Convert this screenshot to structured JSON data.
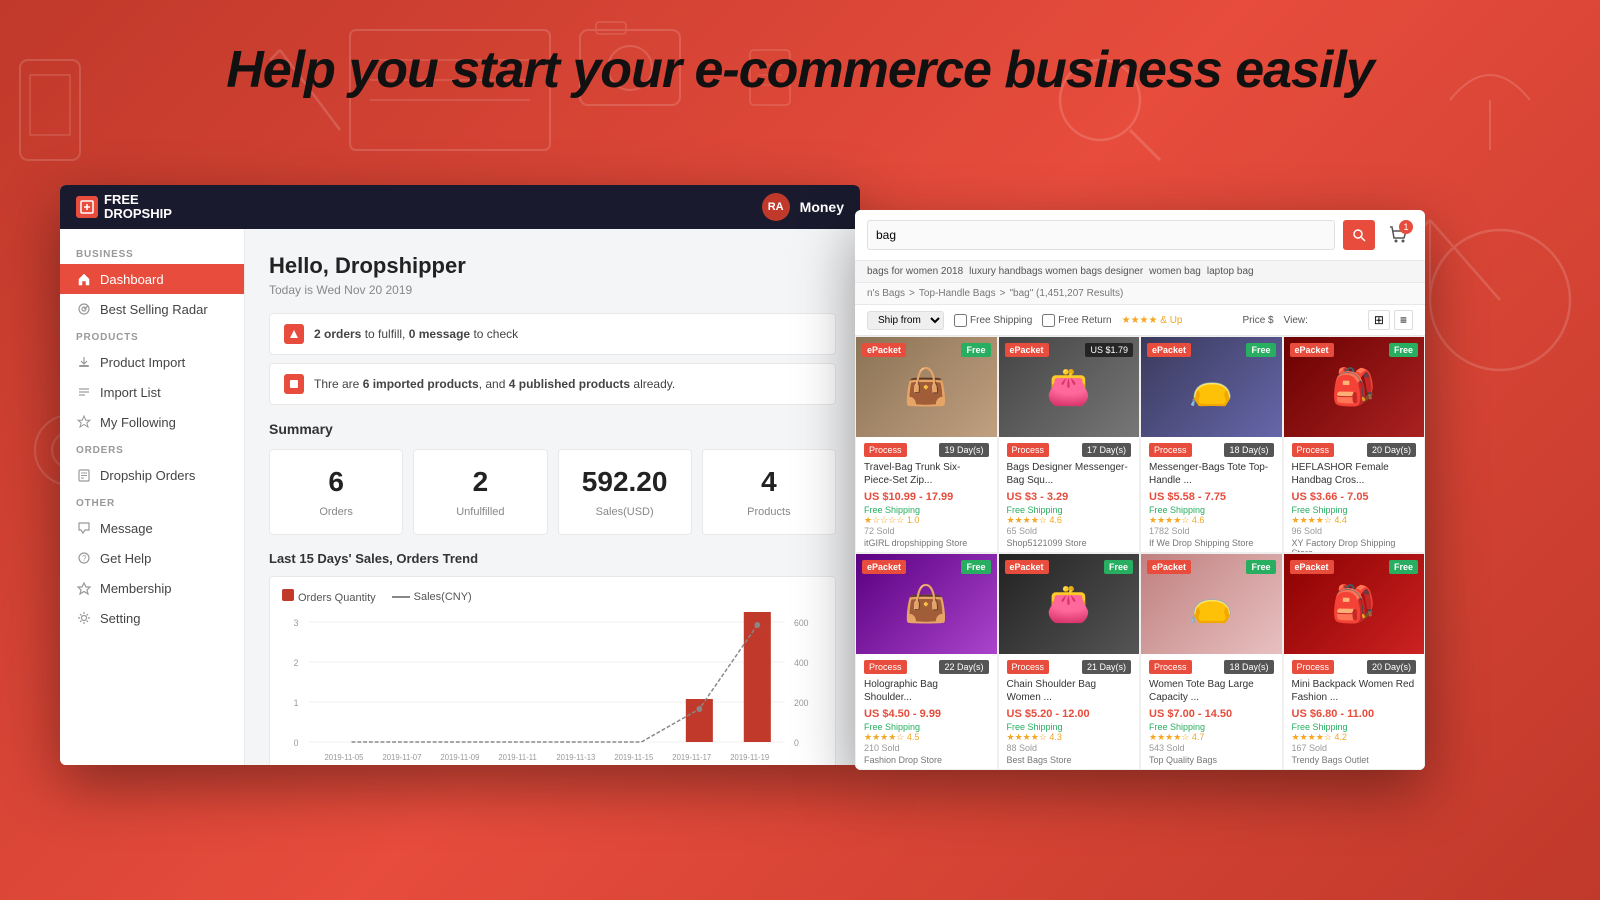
{
  "page": {
    "headline": "Help you start your e-commerce business easily"
  },
  "dashboard": {
    "topbar": {
      "logo_line1": "FREE",
      "logo_line2": "DROPSHIP",
      "avatar": "RA",
      "money_label": "Money"
    },
    "sidebar": {
      "section_business": "BUSINESS",
      "section_products": "PRODUCTS",
      "section_orders": "ORDERS",
      "section_other": "OTHER",
      "items": [
        {
          "id": "dashboard",
          "label": "Dashboard",
          "active": true
        },
        {
          "id": "best-selling-radar",
          "label": "Best Selling Radar",
          "active": false
        },
        {
          "id": "product-import",
          "label": "Product Import",
          "active": false
        },
        {
          "id": "import-list",
          "label": "Import List",
          "active": false
        },
        {
          "id": "my-following",
          "label": "My Following",
          "active": false
        },
        {
          "id": "dropship-orders",
          "label": "Dropship Orders",
          "active": false
        },
        {
          "id": "message",
          "label": "Message",
          "active": false
        },
        {
          "id": "get-help",
          "label": "Get Help",
          "active": false
        },
        {
          "id": "membership",
          "label": "Membership",
          "active": false
        },
        {
          "id": "setting",
          "label": "Setting",
          "active": false
        }
      ]
    },
    "greeting": "Hello, Dropshipper",
    "date": "Today is Wed Nov 20 2019",
    "alerts": [
      {
        "text_parts": [
          "2 orders",
          " to fulfill, ",
          "0 message",
          " to check"
        ]
      },
      {
        "text_parts": [
          "Thre are ",
          "6 imported products",
          ", and ",
          "4 published products",
          " already."
        ]
      }
    ],
    "summary_title": "Summary",
    "summary_cards": [
      {
        "value": "6",
        "label": "Orders"
      },
      {
        "value": "2",
        "label": "Unfulfilled"
      },
      {
        "value": "592.20",
        "label": "Sales(USD)"
      },
      {
        "value": "4",
        "label": "Products"
      }
    ],
    "chart_title": "Last 15 Days' Sales, Orders Trend",
    "chart_legend": {
      "orders": "Orders Quantity",
      "sales": "Sales(CNY)"
    },
    "chart_dates": [
      "2019-11-05",
      "2019-11-07",
      "2019-11-09",
      "2019-11-11",
      "2019-11-13",
      "2019-11-15",
      "2019-11-17",
      "2019-11-19"
    ],
    "chart_orders": [
      0,
      0,
      0,
      0,
      0,
      0,
      1,
      3
    ],
    "chart_sales": [
      0,
      0,
      0,
      0,
      0,
      0,
      150,
      580
    ]
  },
  "ecommerce": {
    "search_value": "bag",
    "search_tags": [
      "bags for women 2018",
      "luxury handbags women bags designer",
      "women bag",
      "laptop bag"
    ],
    "breadcrumb": [
      "n's Bags",
      "Top-Handle Bags",
      "\"bag\" (1,451,207 Results)"
    ],
    "filter_sort": "Ship from",
    "filter_free_shipping": "Free Shipping",
    "filter_free_return": "Free Return",
    "filter_stars": "& Up",
    "filter_price": "Price $",
    "filter_view": "View:",
    "cart_count": "1",
    "products": [
      {
        "badge": "ePacket",
        "badge_type": "red",
        "free_label": "Free",
        "process": "Process",
        "days": "19 Day(s)",
        "name": "Travel-Bag Trunk Six-Piece-Set Zip...",
        "price": "US $10.99 - 17.99",
        "shipping": "Free Shipping",
        "stars": "1.0",
        "sold": "72 Sold",
        "store": "itGIRL dropshipping Store",
        "color": "#8B7355"
      },
      {
        "badge": "ePacket",
        "badge_type": "red",
        "price_label": "US $1.79",
        "process": "Process",
        "days": "17 Day(s)",
        "name": "Bags Designer Messenger-Bag Squ...",
        "price": "US $3 - 3.29",
        "shipping": "Free Shipping",
        "stars": "4.6",
        "sold": "65 Sold",
        "store": "Shop5121099 Store",
        "color": "#5a5a5a"
      },
      {
        "badge": "ePacket",
        "badge_type": "red",
        "free_label": "Free",
        "process": "Process",
        "days": "18 Day(s)",
        "name": "Messenger-Bags Tote Top-Handle ...",
        "price": "US $5.58 - 7.75",
        "shipping": "Free Shipping",
        "stars": "4.6",
        "sold": "1782 Sold",
        "store": "If We Drop Shipping Store",
        "color": "#555577"
      },
      {
        "badge": "ePacket",
        "badge_type": "red",
        "free_label": "Free",
        "process": "Process",
        "days": "20 Day(s)",
        "name": "HEFLASHOR Female Handbag Cros...",
        "price": "US $3.66 - 7.05",
        "shipping": "Free Shipping",
        "stars": "4.4",
        "sold": "96 Sold",
        "store": "XY Factory Drop Shipping Store",
        "color": "#8B0000"
      },
      {
        "badge": "ePacket",
        "badge_type": "red",
        "free_label": "Free",
        "process": "Process",
        "days": "22 Day(s)",
        "name": "Holographic Bag Shoulder...",
        "price": "US $4.50 - 9.99",
        "shipping": "Free Shipping",
        "stars": "4.5",
        "sold": "210 Sold",
        "store": "Fashion Drop Store",
        "color": "#6a0dad"
      },
      {
        "badge": "ePacket",
        "badge_type": "red",
        "free_label": "Free",
        "process": "Process",
        "days": "21 Day(s)",
        "name": "Chain Shoulder Bag Women ...",
        "price": "US $5.20 - 12.00",
        "shipping": "Free Shipping",
        "stars": "4.3",
        "sold": "88 Sold",
        "store": "Best Bags Store",
        "color": "#222"
      },
      {
        "badge": "ePacket",
        "badge_type": "red",
        "free_label": "Free",
        "process": "Process",
        "days": "18 Day(s)",
        "name": "Women Tote Bag Large Capacity ...",
        "price": "US $7.00 - 14.50",
        "shipping": "Free Shipping",
        "stars": "4.7",
        "sold": "543 Sold",
        "store": "Top Quality Bags",
        "color": "#d4a0a0"
      },
      {
        "badge": "ePacket",
        "badge_type": "red",
        "free_label": "Free",
        "process": "Process",
        "days": "20 Day(s)",
        "name": "Mini Backpack Women Red Fashion ...",
        "price": "US $6.80 - 11.00",
        "shipping": "Free Shipping",
        "stars": "4.2",
        "sold": "167 Sold",
        "store": "Trendy Bags Outlet",
        "color": "#8B0000"
      }
    ]
  }
}
